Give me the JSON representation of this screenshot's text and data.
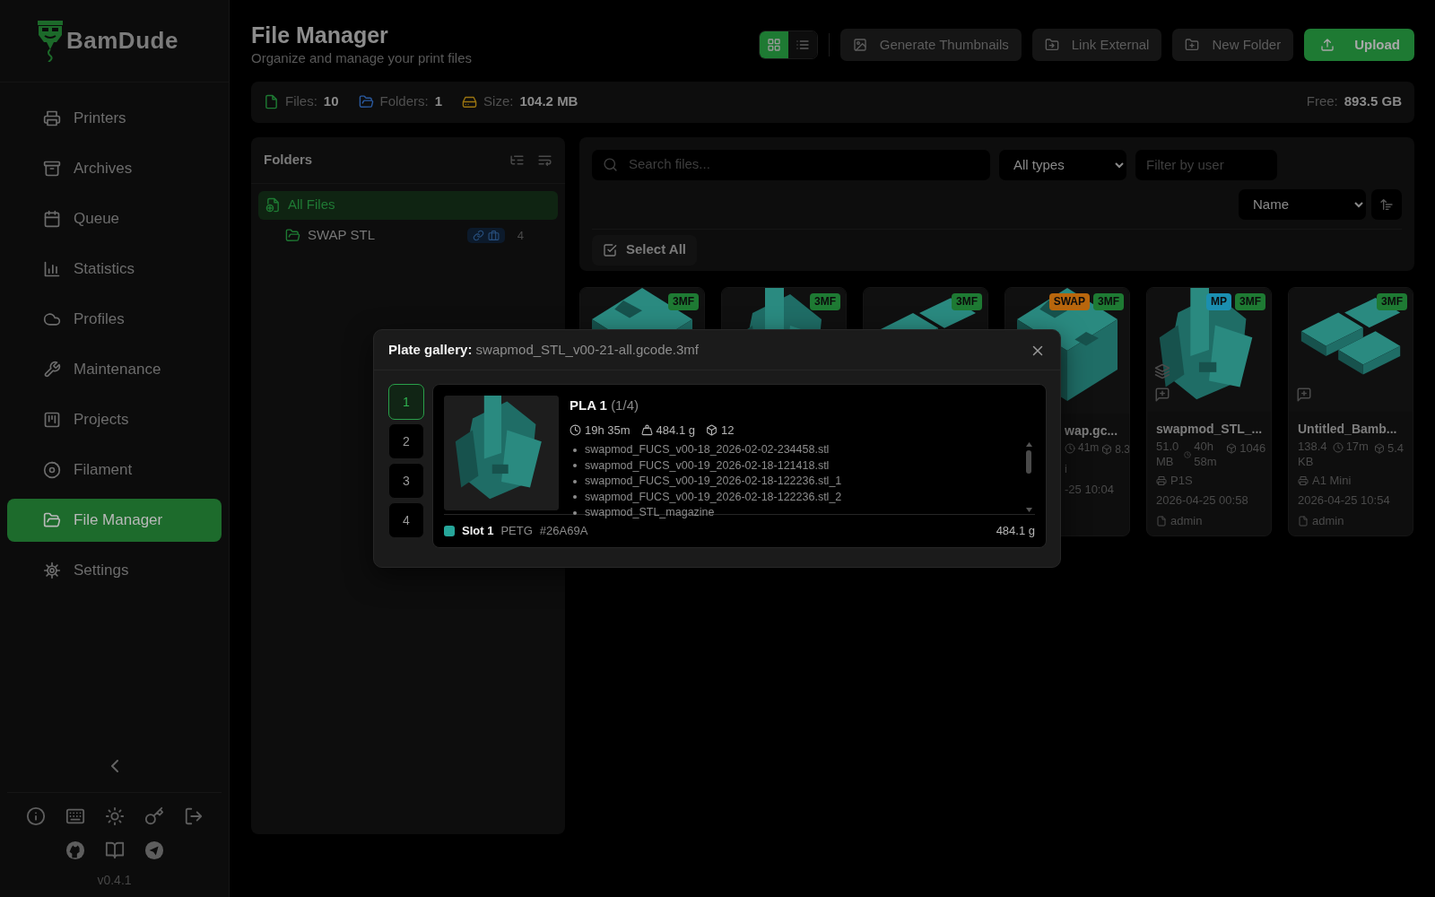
{
  "sidebar": {
    "brand": "BamDude",
    "nav": [
      {
        "label": "Printers",
        "selected": false
      },
      {
        "label": "Archives",
        "selected": false
      },
      {
        "label": "Queue",
        "selected": false
      },
      {
        "label": "Statistics",
        "selected": false
      },
      {
        "label": "Profiles",
        "selected": false
      },
      {
        "label": "Maintenance",
        "selected": false
      },
      {
        "label": "Projects",
        "selected": false
      },
      {
        "label": "Filament",
        "selected": false
      },
      {
        "label": "File Manager",
        "selected": true
      },
      {
        "label": "Settings",
        "selected": false
      }
    ],
    "version": "v0.4.1"
  },
  "header": {
    "title": "File Manager",
    "subtitle": "Organize and manage your print files",
    "view_toggle": [
      {
        "kind": "grid",
        "selected": true
      },
      {
        "kind": "list",
        "selected": false
      }
    ],
    "buttons": [
      {
        "label": "Generate Thumbnails",
        "kind": "secondary"
      },
      {
        "label": "Link External",
        "kind": "secondary"
      },
      {
        "label": "New Folder",
        "kind": "secondary"
      },
      {
        "label": "Upload",
        "kind": "primary"
      }
    ]
  },
  "stats": {
    "files_label": "Files:",
    "files": "10",
    "folders_label": "Folders:",
    "folders": "1",
    "size_label": "Size:",
    "size": "104.2 MB",
    "free_label": "Free:",
    "free": "893.5 GB"
  },
  "folders": {
    "title": "Folders",
    "items": [
      {
        "label": "All Files",
        "selected": true,
        "children": [
          {
            "label": "SWAP STL",
            "selected": false,
            "linked": true,
            "count": "4"
          }
        ]
      }
    ]
  },
  "filters": {
    "search_placeholder": "Search files...",
    "type": "All types",
    "user_placeholder": "Filter by user",
    "sort": "Name",
    "select_all": "Select All"
  },
  "cards": [
    {
      "badges": [
        {
          "label": "3MF",
          "color": "#1e7a33"
        }
      ]
    },
    {
      "badges": [
        {
          "label": "3MF",
          "color": "#1e7a33"
        }
      ]
    },
    {
      "badges": [
        {
          "label": "3MF",
          "color": "#1e7a33"
        }
      ]
    },
    {
      "badges": [
        {
          "label": "SWAP",
          "color": "#b8660d"
        },
        {
          "label": "3MF",
          "color": "#1e7a33"
        }
      ],
      "name": "wap.gc...",
      "time": "41m",
      "weight": "8.3",
      "printer": "i",
      "date": "-25 10:04"
    },
    {
      "badges": [
        {
          "label": "MP",
          "color": "#1b8fb0"
        },
        {
          "label": "3MF",
          "color": "#1e7a33"
        }
      ],
      "multi_plate": true,
      "note_button": true,
      "name": "swapmod_STL_...",
      "size": "51.0 MB",
      "time": "40h 58m",
      "weight": "1046",
      "printer": "P1S",
      "date": "2026-04-25 00:58",
      "user": "admin"
    },
    {
      "badges": [
        {
          "label": "3MF",
          "color": "#1e7a33"
        }
      ],
      "multi_plate": false,
      "note_button": true,
      "name": "Untitled_Bamb...",
      "size": "138.4 KB",
      "time": "17m",
      "weight": "5.4",
      "printer": "A1 Mini",
      "date": "2026-04-25 10:54",
      "user": "admin"
    }
  ],
  "modal": {
    "title": "Plate gallery:",
    "filename": "swapmod_STL_v00-21-all.gcode.3mf",
    "plates": [
      {
        "label": "1",
        "selected": true
      },
      {
        "label": "2",
        "selected": false
      },
      {
        "label": "3",
        "selected": false
      },
      {
        "label": "4",
        "selected": false
      }
    ],
    "plate": {
      "name": "PLA 1",
      "position": "(1/4)",
      "time": "19h 35m",
      "weight": "484.1 g",
      "objects": "12",
      "files": [
        "swapmod_FUCS_v00-18_2026-02-02-234458.stl",
        "swapmod_FUCS_v00-19_2026-02-18-121418.stl",
        "swapmod_FUCS_v00-19_2026-02-18-122236.stl_1",
        "swapmod_FUCS_v00-19_2026-02-18-122236.stl_2",
        "swapmod_STL_magazine"
      ],
      "filament": {
        "slot": "Slot 1",
        "type": "PETG",
        "code": "#26A69A",
        "color": "#26a69a",
        "weight": "484.1 g"
      }
    }
  }
}
